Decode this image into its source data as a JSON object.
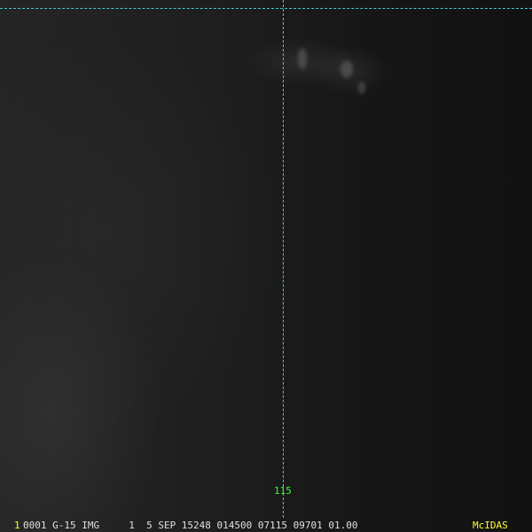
{
  "image": {
    "description_type": "satellite-imagery",
    "colors": {
      "grid": "#3fd0d0",
      "longitude_label": "#33ff33",
      "status_text": "#e0e0e0",
      "highlight_text": "#ffff33"
    }
  },
  "grid": {
    "longitude_label": "115"
  },
  "status_bar": {
    "frame_number": "1",
    "info": "0001 G-15 IMG     1  5 SEP 15248 014500 07115 09701 01.00",
    "product": "McIDAS"
  }
}
